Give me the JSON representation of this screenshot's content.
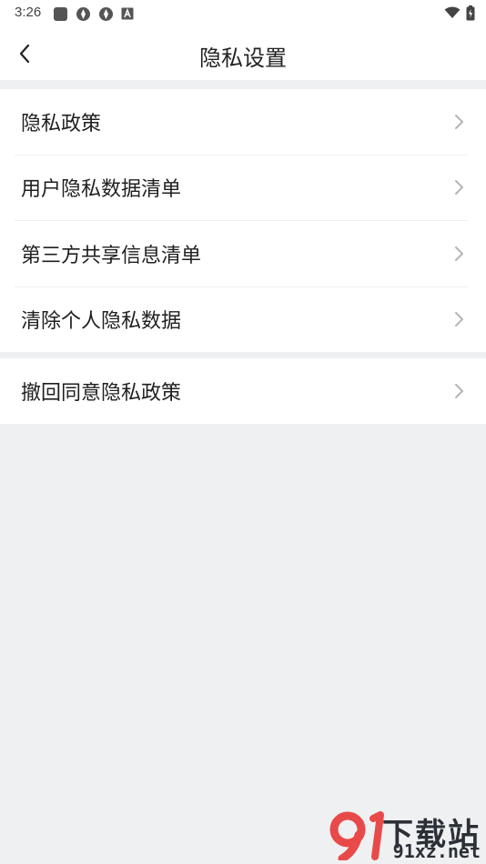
{
  "status_bar": {
    "time": "3:26",
    "icons": [
      "square-icon",
      "circle-logo-icon",
      "circle-logo-icon",
      "a-box-icon"
    ],
    "right_icons": [
      "wifi-icon",
      "battery-icon"
    ]
  },
  "header": {
    "title": "隐私设置",
    "back_icon": "chevron-left-icon"
  },
  "groups": [
    {
      "items": [
        {
          "label": "隐私政策"
        },
        {
          "label": "用户隐私数据清单"
        },
        {
          "label": "第三方共享信息清单"
        },
        {
          "label": "清除个人隐私数据"
        }
      ]
    },
    {
      "items": [
        {
          "label": "撤回同意隐私政策"
        }
      ]
    }
  ],
  "watermark": {
    "top_text": "下载站",
    "bottom_text": "91xz.net",
    "logo_text": "91"
  },
  "colors": {
    "background": "#eff0f2",
    "card": "#ffffff",
    "text": "#1f1f1f",
    "chevron": "#b5b5b8",
    "watermark_red": "#e84a4a"
  }
}
